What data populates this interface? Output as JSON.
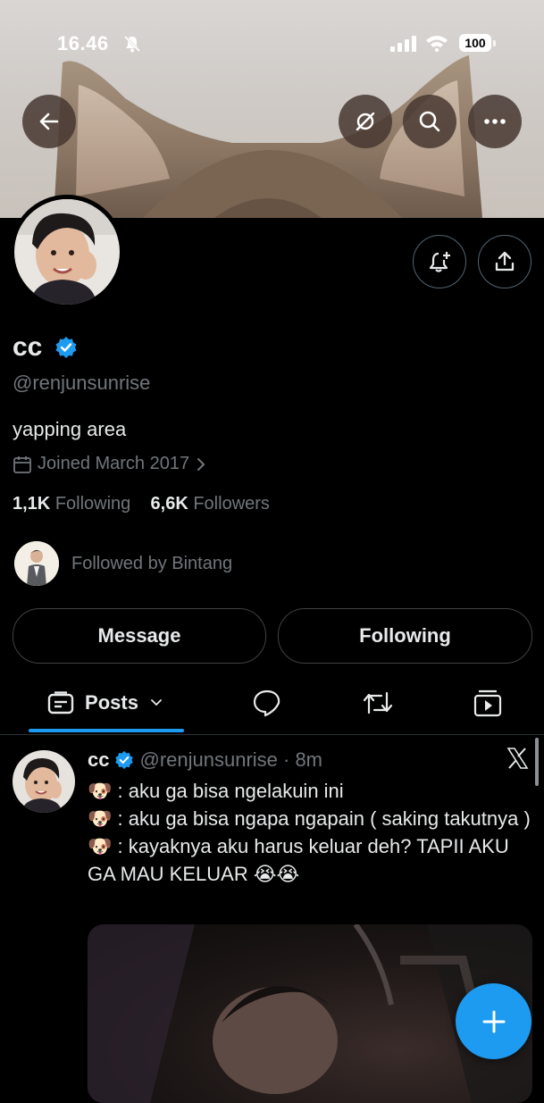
{
  "status_bar": {
    "time": "16.46",
    "battery": "100",
    "icons": [
      "bell-off-icon",
      "signal-icon",
      "wifi-icon",
      "battery-icon"
    ]
  },
  "banner": {
    "top_buttons": [
      "back-arrow-icon",
      "grok-icon",
      "search-icon",
      "more-icon"
    ]
  },
  "profile": {
    "display_name": "cc",
    "handle": "@renjunsunrise",
    "bio": "yapping area",
    "joined": "Joined March 2017",
    "following_count": "1,1K",
    "following_label": "Following",
    "followers_count": "6,6K",
    "followers_label": "Followers",
    "followed_by": "Followed by Bintang"
  },
  "actions": {
    "message": "Message",
    "following": "Following"
  },
  "tabs": {
    "posts": "Posts",
    "icons": [
      "replies-icon",
      "reposts-icon",
      "media-icon"
    ]
  },
  "post": {
    "name": "cc",
    "meta": "@renjunsunrise · 8m",
    "lines": [
      "🐶 : aku ga bisa ngelakuin ini",
      "🐶 : aku ga bisa ngapa ngapain ( saking takutnya )",
      "🐶 : kayaknya aku harus keluar deh? TAPII AKU GA MAU KELUAR 😭😭"
    ]
  },
  "colors": {
    "accent": "#1d9bf0",
    "text": "#e7e9ea",
    "muted": "#71767b",
    "background": "#000000"
  }
}
